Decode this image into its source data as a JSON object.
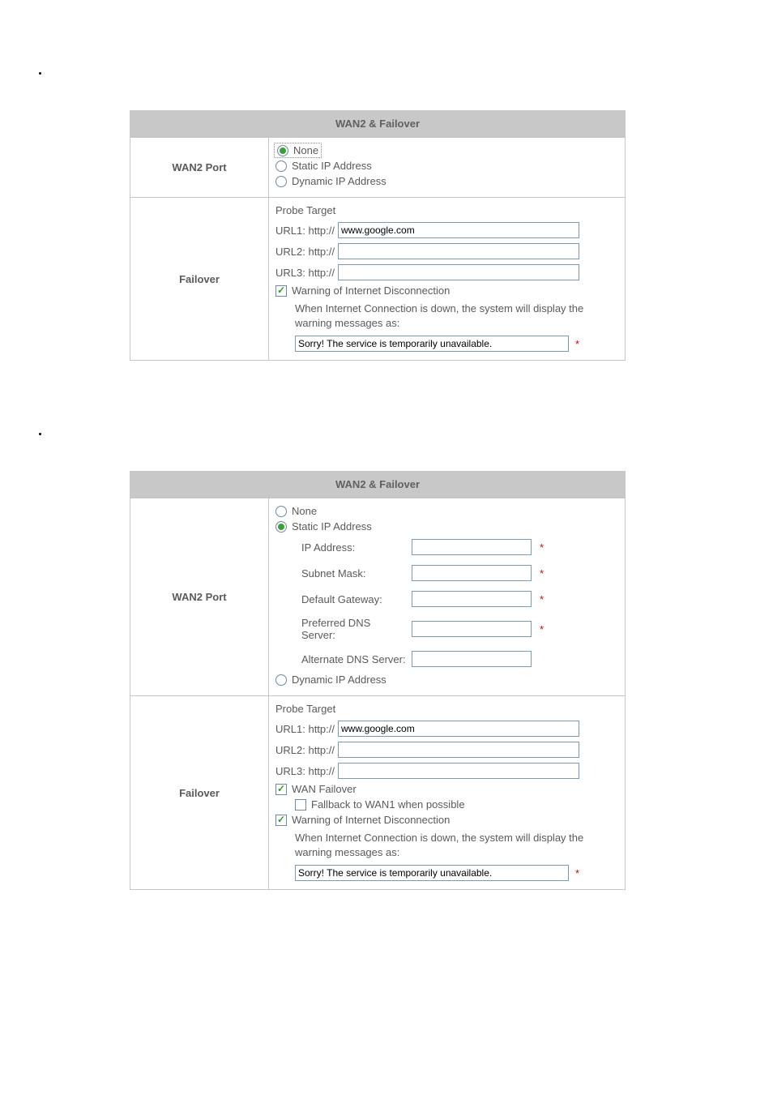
{
  "panel1": {
    "title": "WAN2 & Failover",
    "wan2port": {
      "label": "WAN2 Port",
      "opt_none": "None",
      "opt_static": "Static IP Address",
      "opt_dynamic": "Dynamic IP Address"
    },
    "failover": {
      "label": "Failover",
      "probe_target": "Probe Target",
      "url1_label": "URL1: http://",
      "url1_value": "www.google.com",
      "url2_label": "URL2: http://",
      "url2_value": "",
      "url3_label": "URL3: http://",
      "url3_value": "",
      "warn_check": "Warning of Internet Disconnection",
      "warn_desc": "When Internet Connection is down, the system will display the warning messages as:",
      "warn_msg": "Sorry! The service is temporarily unavailable."
    }
  },
  "panel2": {
    "title": "WAN2 & Failover",
    "wan2port": {
      "label": "WAN2 Port",
      "opt_none": "None",
      "opt_static": "Static IP Address",
      "ip_address_label": "IP Address:",
      "ip_address_value": "",
      "subnet_label": "Subnet Mask:",
      "subnet_value": "",
      "gateway_label": "Default Gateway:",
      "gateway_value": "",
      "pdns_label": "Preferred DNS Server:",
      "pdns_value": "",
      "adns_label": "Alternate DNS Server:",
      "adns_value": "",
      "opt_dynamic": "Dynamic IP Address"
    },
    "failover": {
      "label": "Failover",
      "probe_target": "Probe Target",
      "url1_label": "URL1: http://",
      "url1_value": "www.google.com",
      "url2_label": "URL2: http://",
      "url2_value": "",
      "url3_label": "URL3: http://",
      "url3_value": "",
      "wan_failover": "WAN Failover",
      "fallback": "Fallback to WAN1 when possible",
      "warn_check": "Warning of Internet Disconnection",
      "warn_desc": "When Internet Connection is down, the system will display the warning messages as:",
      "warn_msg": "Sorry! The service is temporarily unavailable."
    }
  }
}
